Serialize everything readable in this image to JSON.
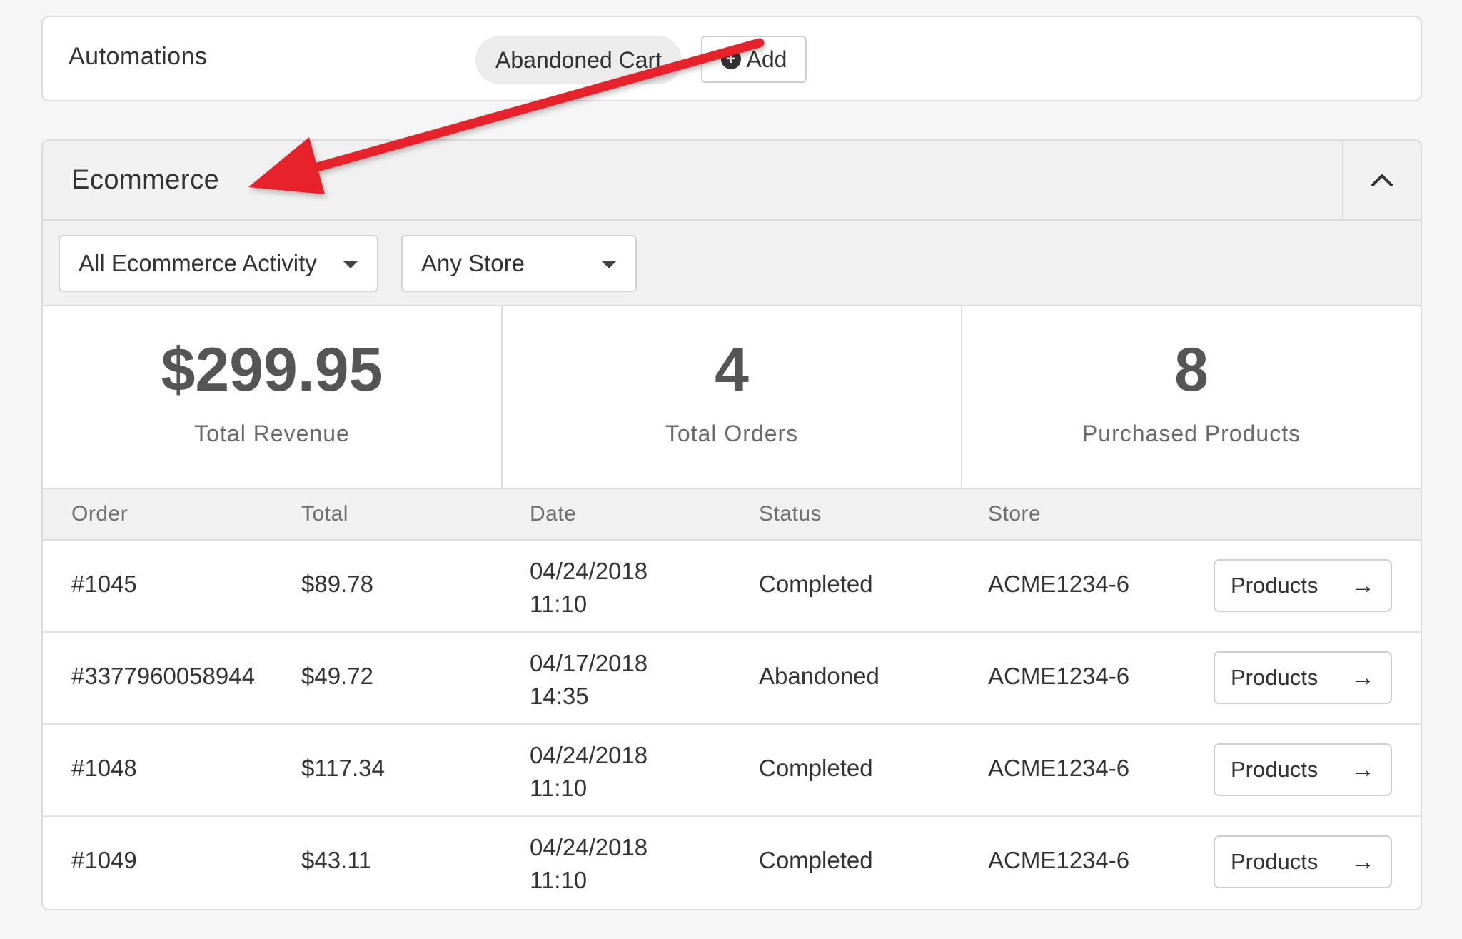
{
  "automations": {
    "label": "Automations",
    "chip_label": "Abandoned Cart",
    "add_label": "Add",
    "add_icon": "+"
  },
  "ecommerce": {
    "title": "Ecommerce",
    "collapse_icon": "chevron-up-icon",
    "filters": {
      "activity": "All Ecommerce Activity",
      "store": "Any Store"
    },
    "stats": [
      {
        "value": "$299.95",
        "label": "Total Revenue"
      },
      {
        "value": "4",
        "label": "Total Orders"
      },
      {
        "value": "8",
        "label": "Purchased Products"
      }
    ],
    "table": {
      "headers": [
        "Order",
        "Total",
        "Date",
        "Status",
        "Store"
      ],
      "rows": [
        {
          "order": "#1045",
          "total": "$89.78",
          "date": "04/24/2018",
          "time": "11:10",
          "status": "Completed",
          "store": "ACME1234-6",
          "button": "Products"
        },
        {
          "order": "#3377960058944",
          "total": "$49.72",
          "date": "04/17/2018",
          "time": "14:35",
          "status": "Abandoned",
          "store": "ACME1234-6",
          "button": "Products"
        },
        {
          "order": "#1048",
          "total": "$117.34",
          "date": "04/24/2018",
          "time": "11:10",
          "status": "Completed",
          "store": "ACME1234-6",
          "button": "Products"
        },
        {
          "order": "#1049",
          "total": "$43.11",
          "date": "04/24/2018",
          "time": "11:10",
          "status": "Completed",
          "store": "ACME1234-6",
          "button": "Products"
        }
      ],
      "button_arrow": "→"
    }
  },
  "annotation": {
    "type": "red-arrow",
    "color": "#e8202a"
  }
}
